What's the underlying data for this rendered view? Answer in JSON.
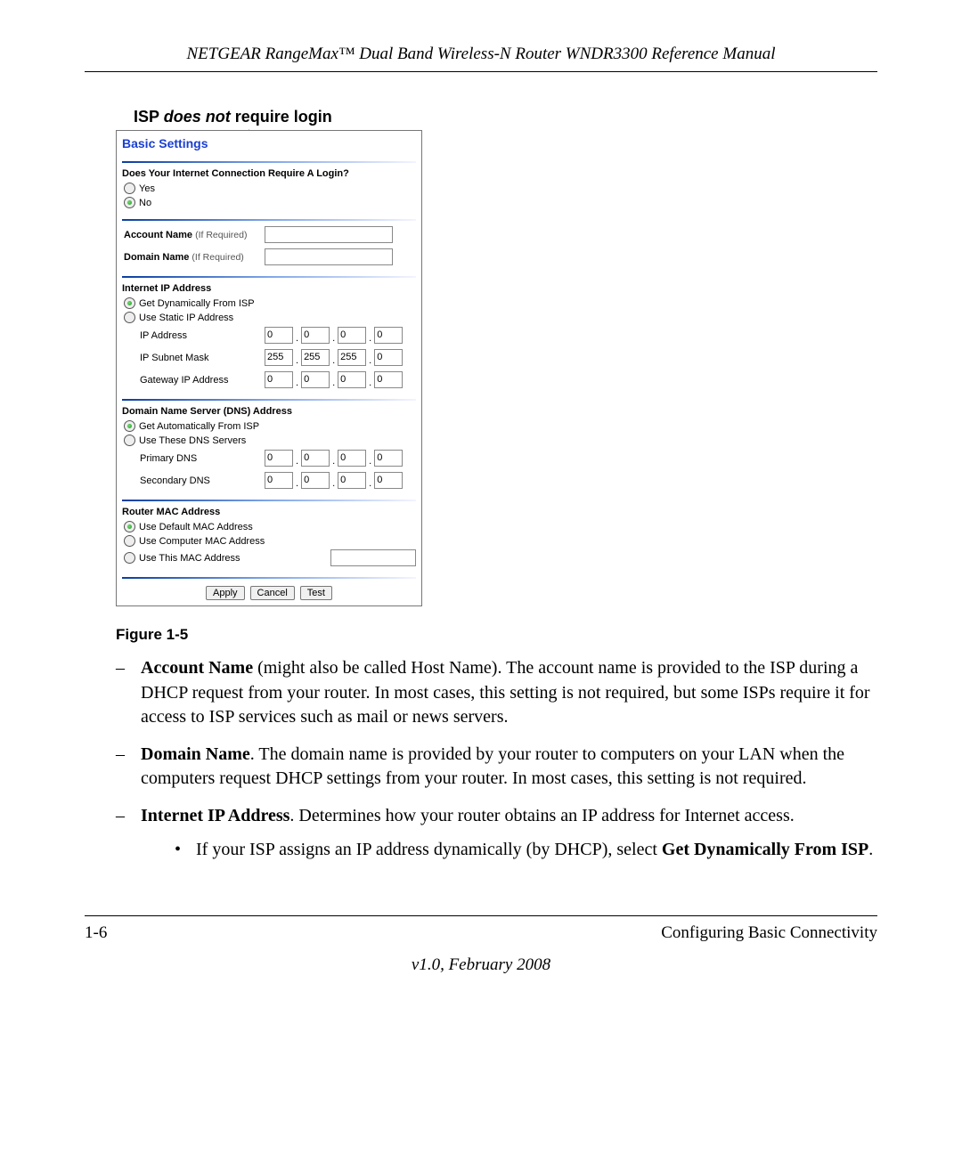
{
  "header": "NETGEAR RangeMax™ Dual Band Wireless-N Router WNDR3300 Reference Manual",
  "callout": {
    "pre": "ISP ",
    "ital": "does not",
    "post": " require login"
  },
  "panel": {
    "title": "Basic Settings",
    "login_q": "Does Your Internet Connection Require A Login?",
    "yes": "Yes",
    "no": "No",
    "account_name_label": "Account Name",
    "if_required": "(If Required)",
    "domain_name_label": "Domain Name",
    "ip_section": "Internet IP Address",
    "ip_opt1": "Get Dynamically From ISP",
    "ip_opt2": "Use Static IP Address",
    "ip_address_label": "IP Address",
    "ip_subnet_label": "IP Subnet Mask",
    "gateway_label": "Gateway IP Address",
    "ip_address": [
      "0",
      "0",
      "0",
      "0"
    ],
    "subnet": [
      "255",
      "255",
      "255",
      "0"
    ],
    "gateway": [
      "0",
      "0",
      "0",
      "0"
    ],
    "dns_section": "Domain Name Server (DNS) Address",
    "dns_opt1": "Get Automatically From ISP",
    "dns_opt2": "Use These DNS Servers",
    "primary_dns_label": "Primary DNS",
    "secondary_dns_label": "Secondary DNS",
    "primary_dns": [
      "0",
      "0",
      "0",
      "0"
    ],
    "secondary_dns": [
      "0",
      "0",
      "0",
      "0"
    ],
    "mac_section": "Router MAC Address",
    "mac_opt1": "Use Default MAC Address",
    "mac_opt2": "Use Computer MAC Address",
    "mac_opt3": "Use This MAC Address",
    "btn_apply": "Apply",
    "btn_cancel": "Cancel",
    "btn_test": "Test"
  },
  "figure_caption": "Figure 1-5",
  "body": {
    "item1_bold": "Account Name",
    "item1_text": " (might also be called Host Name). The account name is provided to the ISP during a DHCP request from your router. In most cases, this setting is not required, but some ISPs require it for access to ISP services such as mail or news servers.",
    "item2_bold": "Domain Name",
    "item2_text": ". The domain name is provided by your router to computers on your LAN when the computers request DHCP settings from your router. In most cases, this setting is not required.",
    "item3_bold": "Internet IP Address",
    "item3_text": ". Determines how your router obtains an IP address for Internet access.",
    "sub1_pre": "If your ISP assigns an IP address dynamically (by DHCP), select ",
    "sub1_bold": "Get Dynamically From ISP",
    "sub1_post": "."
  },
  "footer": {
    "left": "1-6",
    "right": "Configuring Basic Connectivity",
    "version": "v1.0, February 2008"
  }
}
